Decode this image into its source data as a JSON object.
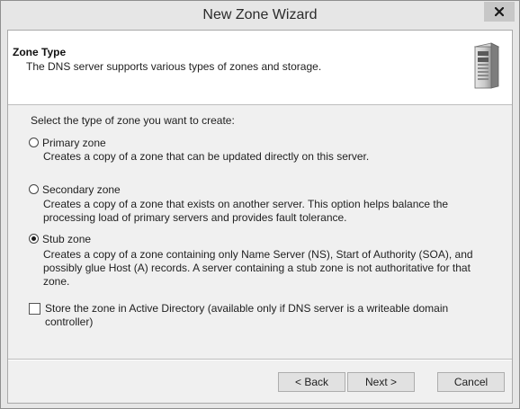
{
  "window": {
    "title": "New Zone Wizard"
  },
  "header": {
    "title": "Zone Type",
    "subtitle": "The DNS server supports various types of zones and storage."
  },
  "main": {
    "intro": "Select the type of zone you want to create:",
    "options": [
      {
        "label": "Primary zone",
        "checked": false,
        "description": "Creates a copy of a zone that can be updated directly on this server."
      },
      {
        "label": "Secondary zone",
        "checked": false,
        "description": "Creates a copy of a zone that exists on another server. This option helps balance the processing load of primary servers and provides fault tolerance."
      },
      {
        "label": "Stub zone",
        "checked": true,
        "description": "Creates a copy of a zone containing only Name Server (NS), Start of Authority (SOA), and possibly glue Host (A) records. A server containing a stub zone is not authoritative for that zone."
      }
    ],
    "store_ad": {
      "label": "Store the zone in Active Directory (available only if DNS server is a writeable domain controller)",
      "checked": false
    }
  },
  "buttons": {
    "back": "< Back",
    "next": "Next >",
    "cancel": "Cancel"
  },
  "icons": {
    "close": "close-icon",
    "server": "server-icon"
  },
  "colors": {
    "titlebar": "#e6e6e6",
    "close_button": "#c7c7c7",
    "header_bg": "#ffffff",
    "client_bg": "#f0f0f0"
  }
}
